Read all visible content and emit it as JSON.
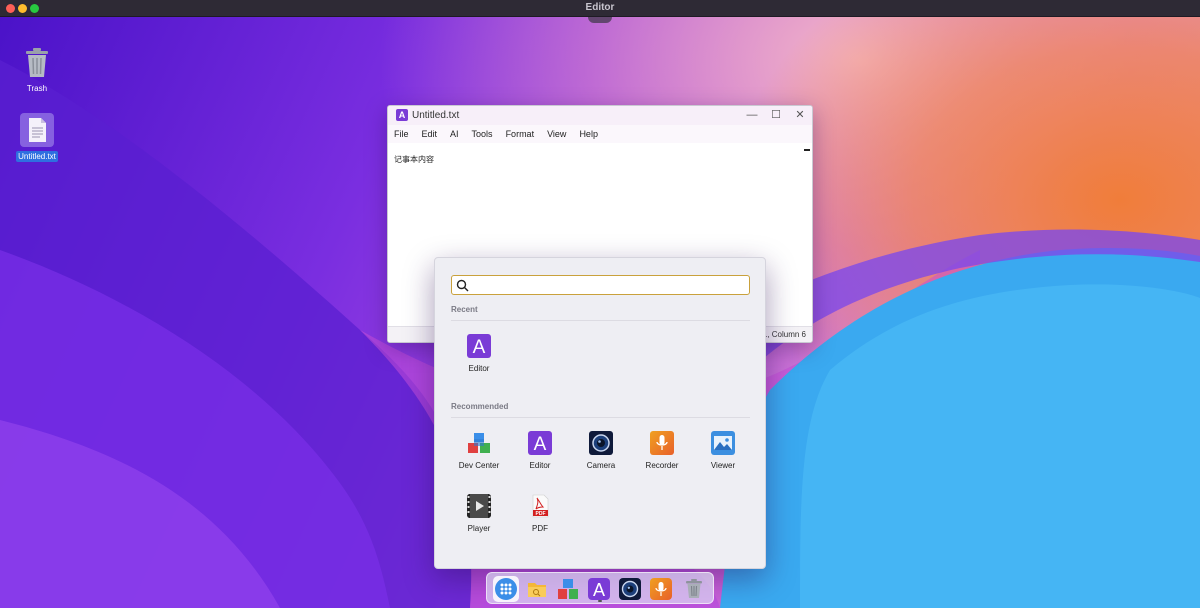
{
  "topbar": {
    "title": "Editor"
  },
  "desktop": {
    "icons": [
      {
        "label": "Trash",
        "icon": "trash-icon"
      },
      {
        "label": "Untitled.txt",
        "icon": "text-file-icon"
      }
    ]
  },
  "editor": {
    "title": "Untitled.txt",
    "app_icon_letter": "A",
    "controls": {
      "minimize": "—",
      "maximize": "☐",
      "close": "✕"
    },
    "menu": [
      "File",
      "Edit",
      "AI",
      "Tools",
      "Format",
      "View",
      "Help"
    ],
    "content": "记事本内容",
    "status": "1, Column 6"
  },
  "launcher": {
    "search": {
      "value": "",
      "placeholder": ""
    },
    "recent_title": "Recent",
    "recent": [
      {
        "label": "Editor",
        "icon": "editor-icon"
      }
    ],
    "recommended_title": "Recommended",
    "recommended": [
      {
        "label": "Dev Center",
        "icon": "cubes-icon"
      },
      {
        "label": "Editor",
        "icon": "editor-icon"
      },
      {
        "label": "Camera",
        "icon": "camera-icon"
      },
      {
        "label": "Recorder",
        "icon": "microphone-icon"
      },
      {
        "label": "Viewer",
        "icon": "image-icon"
      },
      {
        "label": "Player",
        "icon": "film-icon"
      },
      {
        "label": "PDF",
        "icon": "pdf-icon"
      }
    ]
  },
  "dock": {
    "items": [
      "launcher-grid-icon",
      "files-icon",
      "cubes-icon",
      "editor-icon",
      "camera-icon",
      "microphone-icon",
      "trash-icon"
    ]
  },
  "colors": {
    "accent": "#7a3bd6",
    "selection": "#2f6fe0",
    "search_border": "#c9a13c"
  }
}
